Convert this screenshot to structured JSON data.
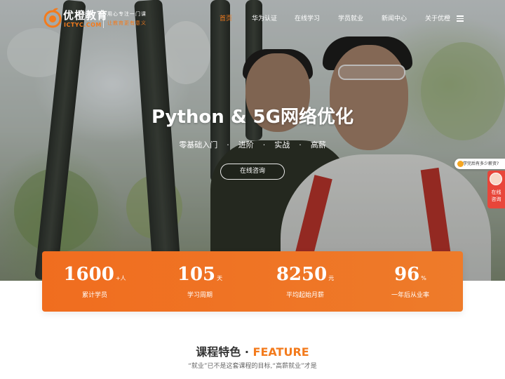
{
  "brand": {
    "name": "优橙教育",
    "domain": "ICTYC.COM",
    "slogan_line1": "用心专注一门课",
    "slogan_line2": "让教育更有意义",
    "accent_color": "#f37b1d"
  },
  "nav": {
    "items": [
      {
        "label": "首页",
        "active": true
      },
      {
        "label": "华为认证",
        "active": false
      },
      {
        "label": "在线学习",
        "active": false
      },
      {
        "label": "学员就业",
        "active": false
      },
      {
        "label": "新闻中心",
        "active": false
      },
      {
        "label": "关于优橙",
        "active": false
      }
    ],
    "menu_icon": "hamburger-icon"
  },
  "hero": {
    "title": "Python & 5G网络优化",
    "tags": [
      "零基础入门",
      "进阶",
      "实战",
      "高薪"
    ],
    "separator": "·",
    "cta_label": "在线咨询"
  },
  "side_float": {
    "bubble_text": "学完后有多少薪资?",
    "button_label_line1": "在线",
    "button_label_line2": "咨询",
    "button_color": "#e8463a"
  },
  "stats": [
    {
      "value": "1600",
      "unit": "+人",
      "label": "累计学员"
    },
    {
      "value": "105",
      "unit": "天",
      "label": "学习周期"
    },
    {
      "value": "8250",
      "unit": "元",
      "label": "平均起始月薪"
    },
    {
      "value": "96",
      "unit": "%",
      "label": "一年后从业率"
    }
  ],
  "feature": {
    "title_cn": "课程特色",
    "title_dot": " · ",
    "title_en": "FEATURE",
    "subtitle": "“就业”已不是这套课程的目标,“高薪就业”才是"
  }
}
